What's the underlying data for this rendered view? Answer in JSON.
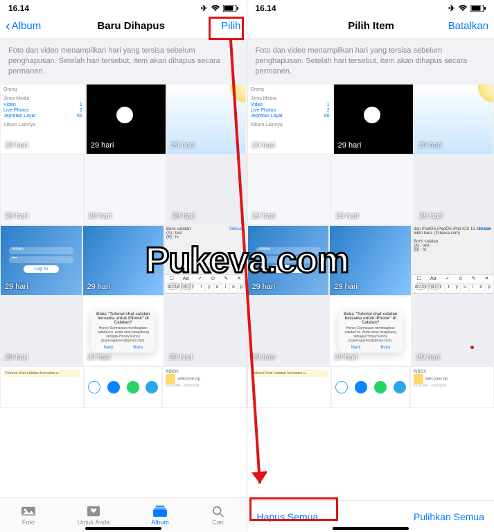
{
  "status": {
    "time": "16.14"
  },
  "left": {
    "nav": {
      "back": "Album",
      "title": "Baru Dihapus",
      "action": "Pilih"
    },
    "notice": "Foto dan video menampilkan hari yang tersisa sebelum penghapusan. Setelah hari tersebut, item akan dihapus secara permanen.",
    "tabs": {
      "foto": "Foto",
      "untuk": "Untuk Anda",
      "album": "Album",
      "cari": "Cari"
    }
  },
  "right": {
    "nav": {
      "title": "Pilih Item",
      "action": "Batalkan"
    },
    "notice": "Foto dan video menampilkan hari yang tersisa sebelum penghapusan. Setelah hari tersebut, item akan dihapus secara permanen.",
    "bottom": {
      "delete": "Hapus Semua",
      "restore": "Pulihkan Semua"
    }
  },
  "days": "29 hari",
  "albumlist": {
    "heading_people": "Orang",
    "heading_media": "Jenis Media",
    "video": "Video",
    "video_n": "1",
    "live": "Live Photos",
    "live_n": "2",
    "screen": "Jepretan Layar",
    "screen_n": "66",
    "other": "Album Lainnya"
  },
  "login": {
    "btn": "Log In",
    "user": "Admin"
  },
  "note": {
    "a": "Boris catatan:",
    "b": "(A) : test",
    "c": "(B) : hi",
    "d": "dan iPadOS iPadOS iPod iOS 13 / 14 dan lebih baru. (Pukeva.com)"
  },
  "kbd": {
    "done": "Selesai"
  },
  "modal": {
    "title": "Buka \"Tutorial chat catatan bersama untuk iPhone\" di Catatan?",
    "sub": "Honey Darmawan membagikan catatan ini. Anda akan bergabung sebagai Honey Kenny (pukevagames@gmail.com).",
    "cancel": "Nanti",
    "open": "Buka"
  },
  "file": {
    "name": "welcome.zip",
    "time": "03:53 AM · 2020/3/24",
    "head": "Tutorial chat catatan bersama u..",
    "folder": "INBOX"
  },
  "watermark": "Pukeva.com"
}
